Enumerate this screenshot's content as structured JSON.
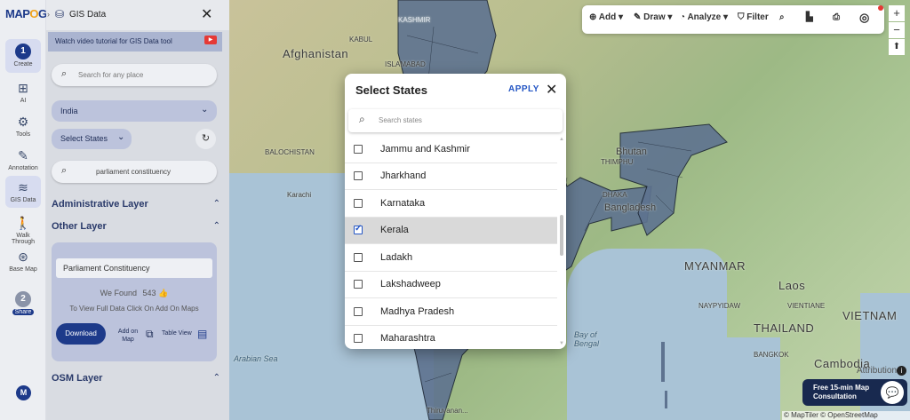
{
  "app": {
    "logo_part1": "MAP",
    "logo_part2": "O",
    "logo_part3": "G"
  },
  "rail": {
    "items": [
      {
        "label": "Create",
        "step": "1"
      },
      {
        "label": "AI"
      },
      {
        "label": "Tools"
      },
      {
        "label": "Annotation"
      },
      {
        "label": "GIS Data"
      },
      {
        "label": "Walk Through"
      },
      {
        "label": "Base Map"
      },
      {
        "label": "Share",
        "step": "2"
      }
    ],
    "avatar": "M"
  },
  "panel": {
    "title": "GIS Data",
    "tutorial": "Watch video tutorial for GIS Data tool",
    "search_placeholder": "Search for any place",
    "country": "India",
    "select_states": "Select States",
    "layer_search": "parliament constituency",
    "admin_layer": "Administrative Layer",
    "other_layer": "Other Layer",
    "result_name": "Parliament Constituency",
    "found_prefix": "We Found",
    "found_count": "543",
    "found_hint": "To View Full Data Click On Add On Maps",
    "download": "Download",
    "add_on_map": "Add on Map",
    "table_view": "Table View",
    "osm_layer": "OSM Layer"
  },
  "toolbar": {
    "add": "Add",
    "draw": "Draw",
    "analyze": "Analyze",
    "filter": "Filter"
  },
  "modal": {
    "title": "Select States",
    "apply": "APPLY",
    "search_placeholder": "Search states",
    "states": [
      {
        "name": "Jammu and Kashmir",
        "checked": false
      },
      {
        "name": "Jharkhand",
        "checked": false
      },
      {
        "name": "Karnataka",
        "checked": false
      },
      {
        "name": "Kerala",
        "checked": true
      },
      {
        "name": "Ladakh",
        "checked": false
      },
      {
        "name": "Lakshadweep",
        "checked": false
      },
      {
        "name": "Madhya Pradesh",
        "checked": false
      },
      {
        "name": "Maharashtra",
        "checked": false
      }
    ]
  },
  "map": {
    "labels": {
      "afghanistan": "Afghanistan",
      "kabul": "KABUL",
      "islamabad": "ISLAMABAD",
      "balochistan": "BALOCHISTAN",
      "karachi": "Karachi",
      "bhutan": "Bhutan",
      "thimphu": "THIMPHU",
      "dhaka": "DHAKA",
      "bangladesh": "Bangladesh",
      "myanmar": "MYANMAR",
      "naypyidaw": "NAYPYIDAW",
      "laos": "Laos",
      "vientiane": "VIENTIANE",
      "vietnam": "VIETNAM",
      "thailand": "THAILAND",
      "bangkok": "BANGKOK",
      "cambodia": "Cambodia",
      "arabian_sea": "Arabian Sea",
      "bay_of_bengal": "Bay of Bengal",
      "thiruvananthapuram": "Thiruvanan...",
      "kashmir": "KASHMIR"
    },
    "attribution_label": "Attribution",
    "copyright": "© MapTiler © OpenStreetMap contributors",
    "consult_line1": "Free 15-min Map",
    "consult_line2": "Consultation"
  }
}
